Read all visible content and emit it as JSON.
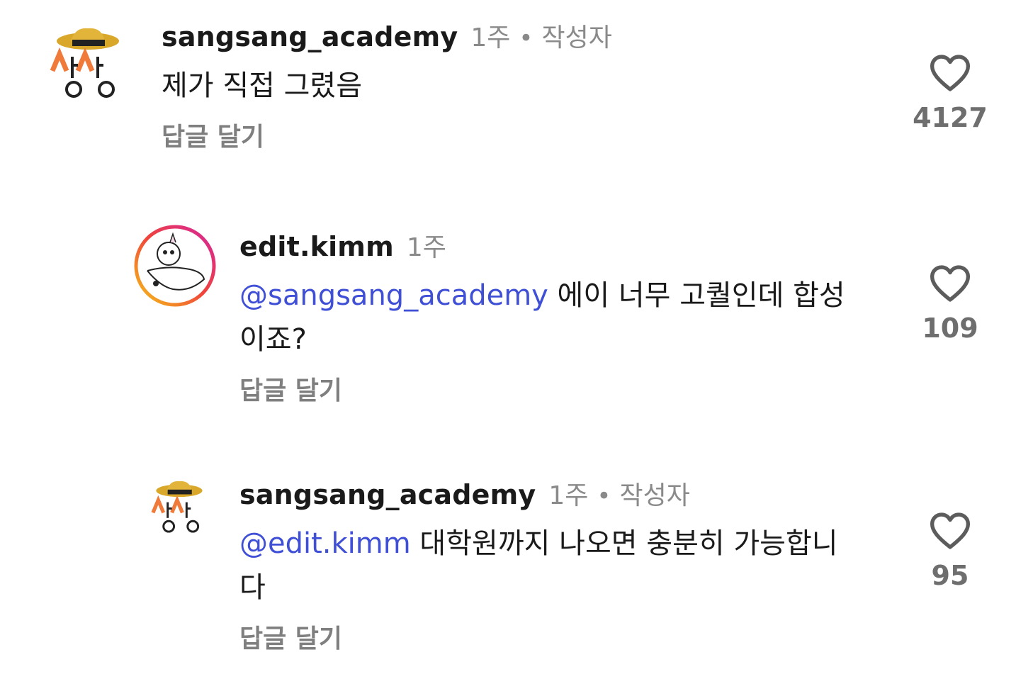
{
  "comments": [
    {
      "username": "sangsang_academy",
      "time": "1주",
      "author_badge": "작성자",
      "mention": "",
      "text": "제가 직접 그렸음",
      "reply_label": "답글 달기",
      "likes": "4127",
      "avatar": "sangsang-logo"
    },
    {
      "username": "edit.kimm",
      "time": "1주",
      "author_badge": "",
      "mention": "@sangsang_academy",
      "text": " 에이 너무 고퀄인데 합성이죠?",
      "reply_label": "답글 달기",
      "likes": "109",
      "avatar": "edit-kimm-drawing"
    },
    {
      "username": "sangsang_academy",
      "time": "1주",
      "author_badge": "작성자",
      "mention": "@edit.kimm",
      "text": " 대학원까지 나오면 충분히 가능합니다",
      "reply_label": "답글 달기",
      "likes": "95",
      "avatar": "sangsang-logo"
    }
  ],
  "icons": {
    "like": "heart-outline-icon"
  },
  "colors": {
    "mention": "#3f4fd6",
    "meta": "#8a8a8a",
    "story_ring_start": "#f5c518",
    "story_ring_end": "#d6249f"
  }
}
